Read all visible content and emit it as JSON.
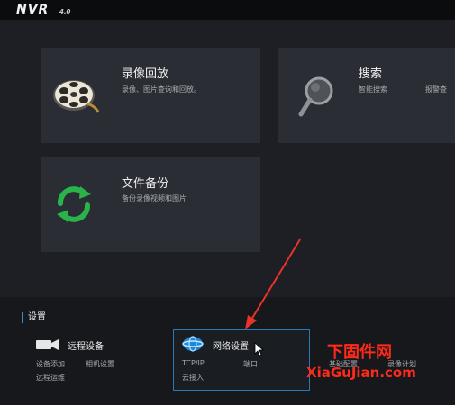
{
  "header": {
    "logo": "NVR",
    "version": "4.0"
  },
  "tiles": [
    {
      "title": "录像回放",
      "desc": "录像、图片查询和回放。",
      "icon": "film-reel-icon"
    },
    {
      "title": "搜索",
      "desc": "智能搜索",
      "desc2": "报警查",
      "icon": "magnifier-icon"
    },
    {
      "title": "文件备份",
      "desc": "备份录像视频和图片",
      "icon": "sync-arrows-icon"
    }
  ],
  "settings": {
    "title": "设置",
    "groups": [
      {
        "title": "远程设备",
        "icon": "camera-icon",
        "links": [
          "设备添加",
          "相机设置",
          "远程运维"
        ]
      },
      {
        "title": "网络设置",
        "icon": "network-globe-icon",
        "links": [
          "TCP/IP",
          "端口",
          "云接入"
        ]
      },
      {
        "title": "基本配置",
        "links": [
          "基础配置",
          "录像计划"
        ]
      }
    ]
  },
  "watermark": {
    "cn": "下固件网",
    "en": "XiaGuJian.com"
  },
  "colors": {
    "accent": "#2a8fd6",
    "tile": "#2a2d33",
    "background": "#1d1f24",
    "annotation": "#e8332a",
    "watermark": "#ff2a1a"
  }
}
